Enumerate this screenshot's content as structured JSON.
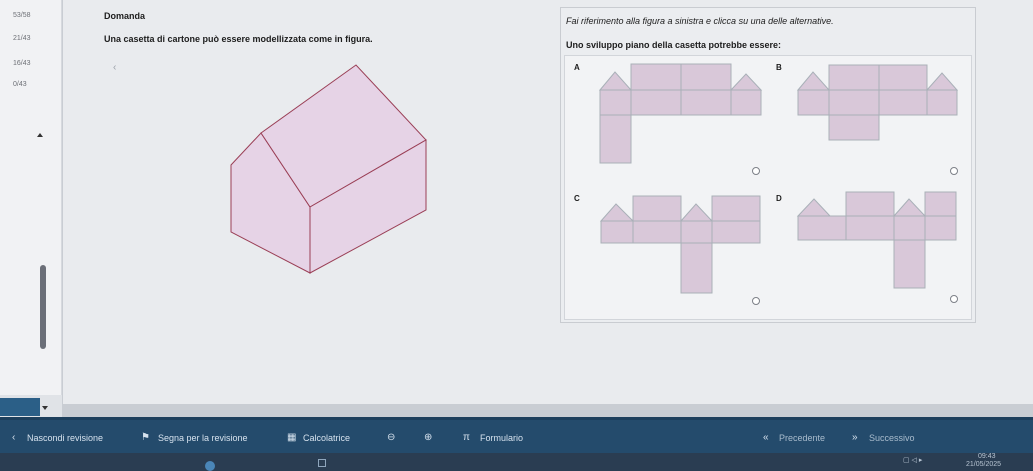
{
  "sidebar": {
    "counts": [
      "53/58",
      "21/43",
      "16/43",
      "0/43"
    ]
  },
  "question": {
    "label": "Domanda",
    "text": "Una casetta di cartone può essere modellizzata come in figura.",
    "instruction": "Fai riferimento alla figura a sinistra e clicca su una delle alternative.",
    "subtitle": "Uno sviluppo piano della casetta potrebbe essere:",
    "options": [
      "A",
      "B",
      "C",
      "D"
    ]
  },
  "toolbar": {
    "hide_review": "Nascondi revisione",
    "mark_review": "Segna per la revisione",
    "calculator": "Calcolatrice",
    "formulary": "Formulario",
    "prev": "Precedente",
    "next": "Successivo"
  },
  "taskbar": {
    "time": "09:43",
    "date": "21/05/2025"
  },
  "colors": {
    "face_fill": "#e6d3e6",
    "face_stroke": "#9a3f56",
    "net_fill": "#d9c8d9",
    "net_stroke": "#a9b0b8",
    "bar": "#244b6c"
  }
}
